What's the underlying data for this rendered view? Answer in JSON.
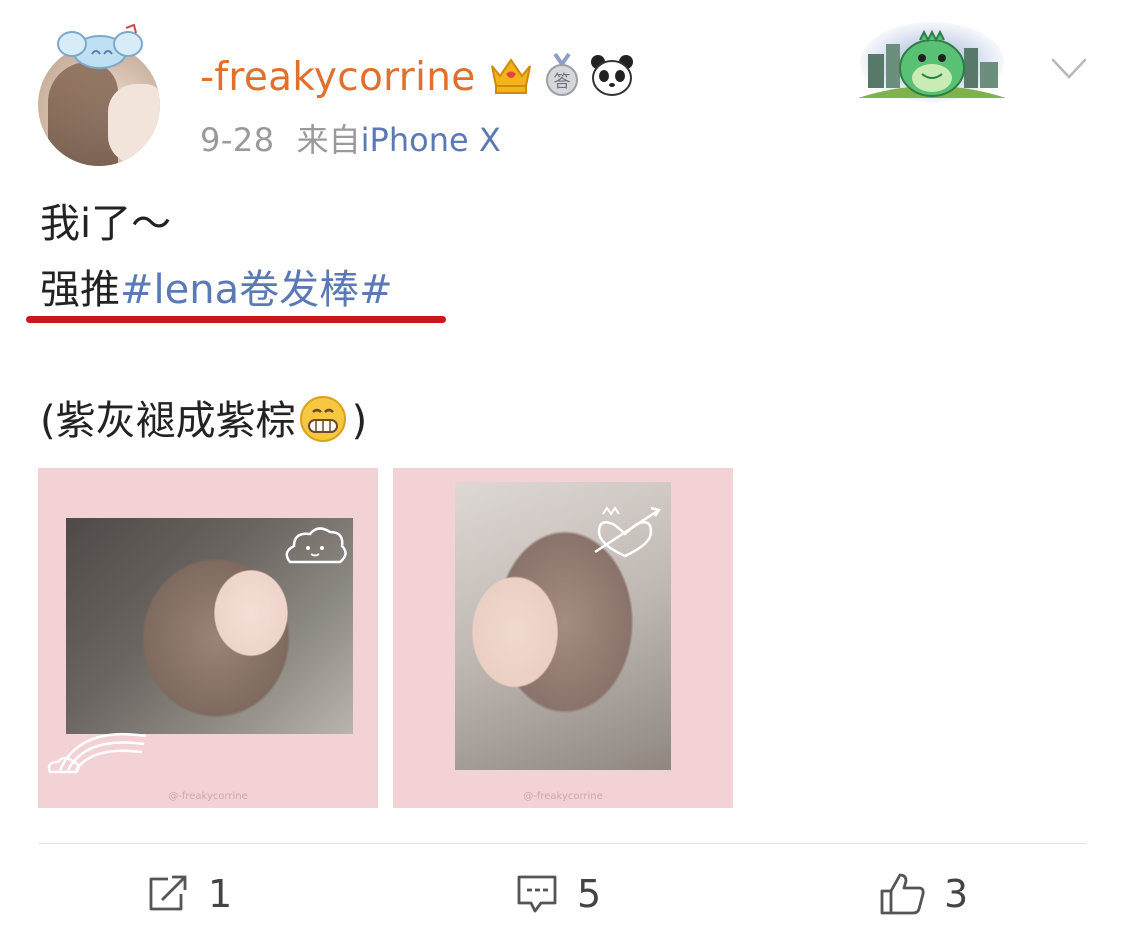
{
  "post": {
    "author": {
      "username": "-freakycorrine",
      "badges": [
        "crown-badge",
        "answer-badge",
        "panda-badge"
      ]
    },
    "meta": {
      "date": "9-28",
      "source_prefix": "来自",
      "source_device": "iPhone X"
    },
    "content": {
      "line1": "我i了～",
      "line2_prefix": "强推",
      "hashtag": "#lena卷发棒#",
      "line3_open": "(紫灰褪成紫棕",
      "line3_close": ")",
      "emoji": "grin-emoji"
    },
    "photos": [
      {
        "name": "photo-1",
        "watermark": "@-freakycorrine"
      },
      {
        "name": "photo-2",
        "watermark": "@-freakycorrine"
      }
    ],
    "actions": {
      "repost_count": "1",
      "comment_count": "5",
      "like_count": "3"
    }
  },
  "colors": {
    "username": "#e0702c",
    "link": "#5b7ab5",
    "underline": "#c7191d",
    "photo_bg": "#f3d2d6"
  }
}
